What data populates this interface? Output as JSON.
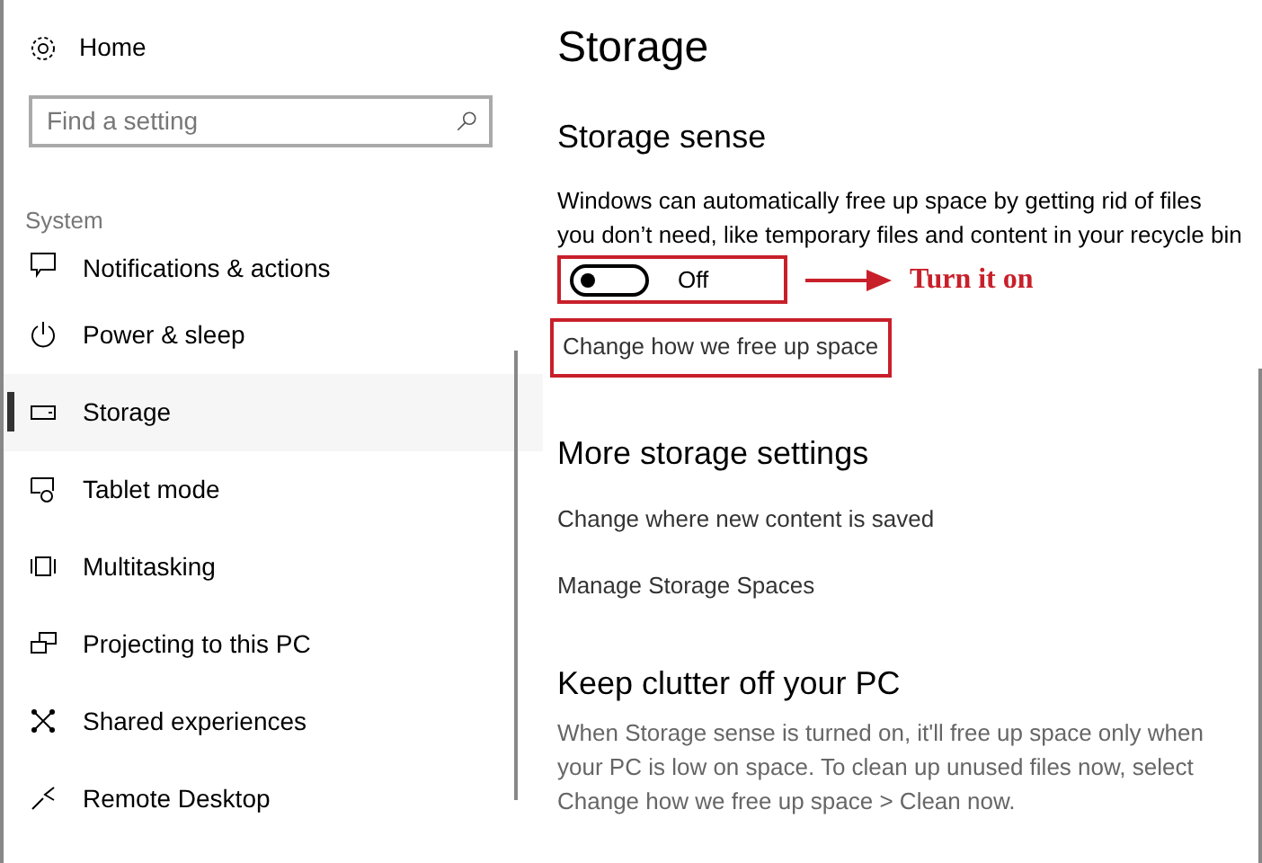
{
  "sidebar": {
    "home": "Home",
    "search": {
      "placeholder": "Find a setting"
    },
    "section": "System",
    "items": [
      {
        "label": "Notifications & actions",
        "selected": false
      },
      {
        "label": "Power & sleep",
        "selected": false
      },
      {
        "label": "Storage",
        "selected": true
      },
      {
        "label": "Tablet mode",
        "selected": false
      },
      {
        "label": "Multitasking",
        "selected": false
      },
      {
        "label": "Projecting to this PC",
        "selected": false
      },
      {
        "label": "Shared experiences",
        "selected": false
      },
      {
        "label": "Remote Desktop",
        "selected": false
      }
    ]
  },
  "main": {
    "title": "Storage",
    "storage_sense": {
      "heading": "Storage sense",
      "description": "Windows can automatically free up space by getting rid of files you don’t need, like temporary files and content in your recycle bin",
      "toggle": {
        "on": false,
        "label": "Off"
      },
      "annotation": "Turn it on",
      "link": "Change how we free up space"
    },
    "more": {
      "heading": "More storage settings",
      "links": [
        "Change where new content is saved",
        "Manage Storage Spaces"
      ]
    },
    "clutter": {
      "heading": "Keep clutter off your PC",
      "text": "When Storage sense is turned on, it'll free up space only when your PC is low on space. To clean up unused files now, select Change how we free up space > Clean now."
    }
  }
}
